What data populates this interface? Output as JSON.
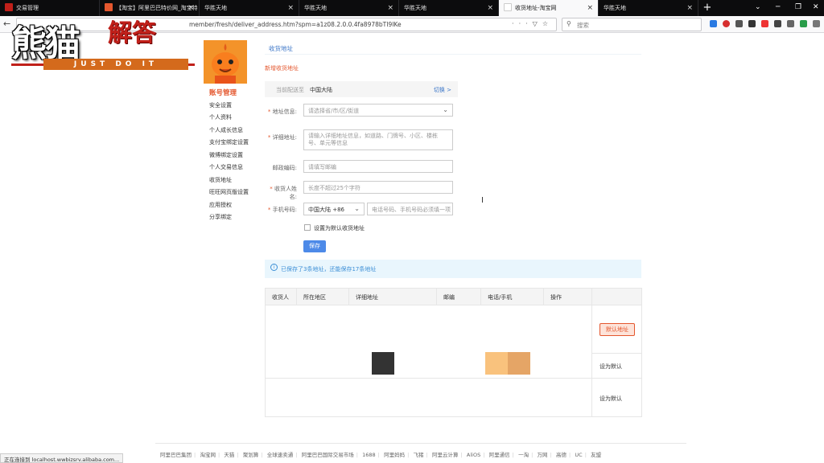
{
  "browser": {
    "tabs": [
      {
        "label": "交易管理",
        "fav": "#c0201a"
      },
      {
        "label": "【淘宝】阿里巴巴特价网_淘宝特",
        "fav": "#e4572e"
      },
      {
        "label": "华胜天地",
        "fav": "#0c0c0d"
      },
      {
        "label": "华胜天地",
        "fav": "#0c0c0d"
      },
      {
        "label": "华胜天地",
        "fav": "#0c0c0d"
      },
      {
        "label": "收货地址-淘宝网",
        "fav": "#ffffff"
      },
      {
        "label": "华胜天地",
        "fav": "#0c0c0d"
      }
    ],
    "new_tab": "+",
    "url": "member/fresh/deliver_address.htm?spm=a1z08.2.0.0.4fa8978bTI9IKe",
    "search_placeholder": "搜索",
    "status": "正在连接到 localhost.wwbizsrv.alibaba.com..."
  },
  "watermark": {
    "main": "熊猫",
    "accent": "解答",
    "sub": "JUST DO IT"
  },
  "sidebar": {
    "title": "账号管理",
    "items": [
      "安全设置",
      "个人资料",
      "个人成长信息",
      "支付宝绑定设置",
      "微博绑定设置",
      "个人交易信息",
      "收货地址",
      "旺旺网页版设置",
      "应用授权",
      "分享绑定"
    ]
  },
  "page": {
    "title": "收货地址",
    "form_title": "新增收货地址",
    "region_label": "当前配送至",
    "region_value": "中国大陆",
    "region_switch": "切换 >",
    "fields": {
      "address_label": "地址信息:",
      "address_placeholder": "请选择省/市/区/街道",
      "detail_label": "详细地址:",
      "detail_placeholder": "请输入详细地址信息，如道路、门牌号、小区、楼栋号、单元等信息",
      "zip_label": "邮政编码:",
      "zip_placeholder": "请填写邮编",
      "name_label": "收货人姓名:",
      "name_placeholder": "长度不超过25个字符",
      "phone_label": "手机号码:",
      "phone_region": "中国大陆 +86",
      "phone_placeholder": "电话号码、手机号码必须填一项",
      "default_checkbox": "设置为默认收货地址"
    },
    "save_button": "保存",
    "info_text": "已保存了3条地址，还能保存17条地址"
  },
  "table": {
    "headers": [
      "收货人",
      "所在地区",
      "详细地址",
      "邮编",
      "电话/手机",
      "操作"
    ],
    "default_badge": "默认地址",
    "set_default": "设为默认"
  },
  "footer": {
    "links": [
      "阿里巴巴集团",
      "淘宝网",
      "天猫",
      "聚划算",
      "全球速卖通",
      "阿里巴巴国际交易市场",
      "1688",
      "阿里妈妈",
      "飞猪",
      "阿里云计算",
      "AliOS",
      "阿里通信",
      "一淘",
      "万网",
      "高德",
      "UC",
      "友盟"
    ]
  }
}
